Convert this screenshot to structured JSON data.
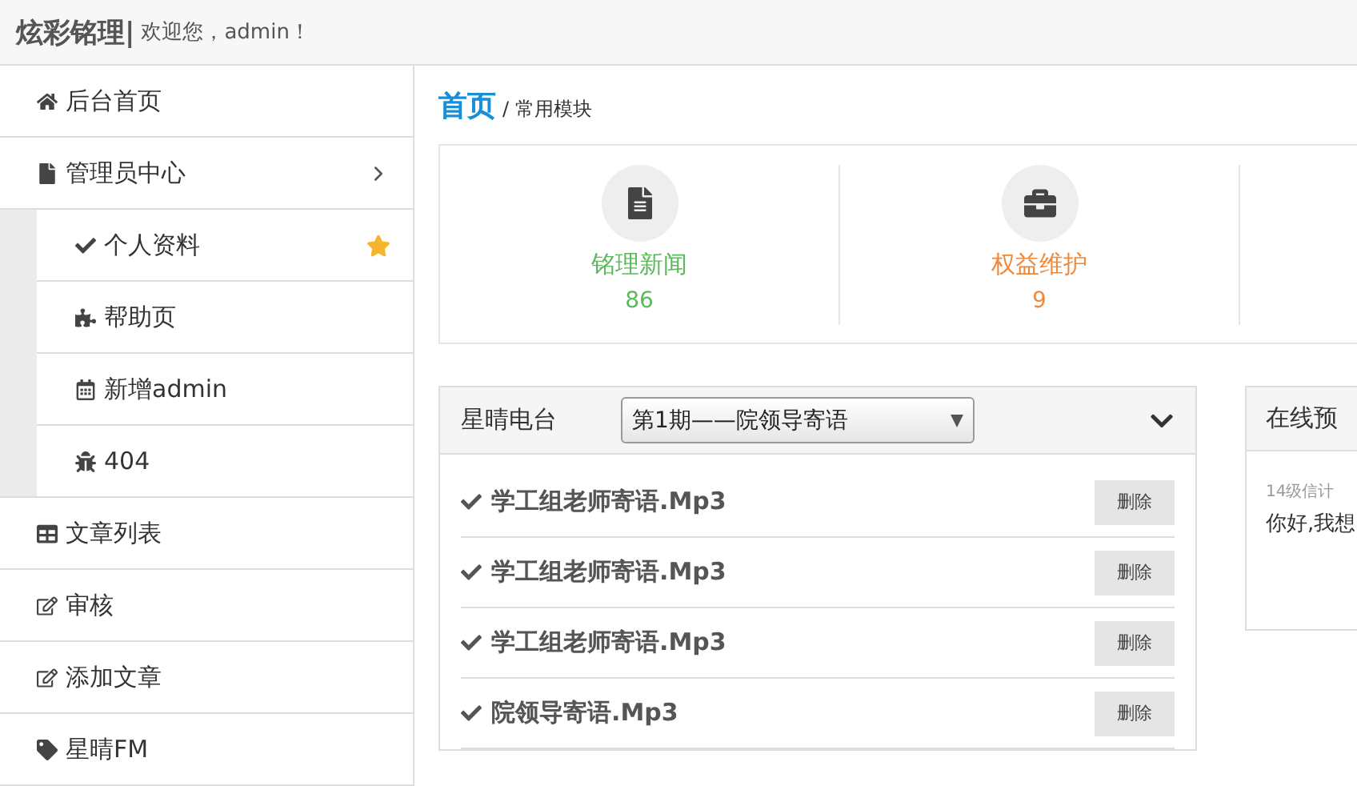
{
  "header": {
    "brand": "炫彩铭理|",
    "welcome": "欢迎您，admin！"
  },
  "sidebar": {
    "items": [
      {
        "label": "后台首页"
      },
      {
        "label": "管理员中心",
        "expanded": true,
        "children": [
          {
            "label": "个人资料",
            "starred": true
          },
          {
            "label": "帮助页",
            "starred": false
          },
          {
            "label": "新增admin",
            "starred": false
          },
          {
            "label": "404",
            "starred": false
          }
        ]
      },
      {
        "label": "文章列表"
      },
      {
        "label": "审核"
      },
      {
        "label": "添加文章"
      },
      {
        "label": "星晴FM"
      }
    ]
  },
  "breadcrumb": {
    "home": "首页",
    "current": "/ 常用模块"
  },
  "stats": [
    {
      "label": "铭理新闻",
      "count": "86",
      "color": "#5cb85c"
    },
    {
      "label": "权益维护",
      "count": "9",
      "color": "#f0883a"
    }
  ],
  "radio_panel": {
    "title": "星晴电台",
    "select": {
      "value": "第1期——院领导寄语"
    },
    "expanded": true,
    "files": [
      {
        "name": "学工组老师寄语.Mp3",
        "action": "删除"
      },
      {
        "name": "学工组老师寄语.Mp3",
        "action": "删除"
      },
      {
        "name": "学工组老师寄语.Mp3",
        "action": "删除"
      },
      {
        "name": "院领导寄语.Mp3",
        "action": "删除"
      }
    ]
  },
  "booking_panel": {
    "title": "在线预",
    "entries": [
      {
        "meta": "14级信计",
        "text": "你好,我想"
      }
    ]
  }
}
